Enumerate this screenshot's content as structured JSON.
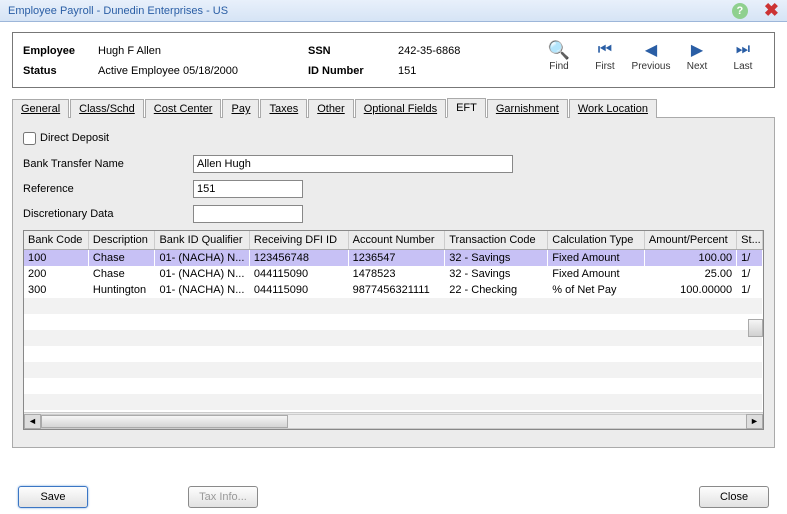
{
  "window": {
    "title": "Employee Payroll - Dunedin Enterprises - US"
  },
  "info": {
    "employee_label": "Employee",
    "employee_value": "Hugh F Allen",
    "status_label": "Status",
    "status_value": "Active Employee 05/18/2000",
    "ssn_label": "SSN",
    "ssn_value": "242-35-6868",
    "id_label": "ID Number",
    "id_value": "151"
  },
  "nav": {
    "find": "Find",
    "first": "First",
    "previous": "Previous",
    "next": "Next",
    "last": "Last"
  },
  "tabs": {
    "general": "General",
    "class": "Class/Schd",
    "cost": "Cost Center",
    "pay": "Pay",
    "taxes": "Taxes",
    "other": "Other",
    "optional": "Optional Fields",
    "eft": "EFT",
    "garnishment": "Garnishment",
    "work": "Work Location"
  },
  "eft": {
    "direct_deposit_label": "Direct Deposit",
    "bank_transfer_label": "Bank Transfer Name",
    "bank_transfer_value": "Allen Hugh",
    "reference_label": "Reference",
    "reference_value": "151",
    "discretionary_label": "Discretionary Data",
    "discretionary_value": ""
  },
  "grid": {
    "headers": {
      "bank_code": "Bank Code",
      "description": "Description",
      "bank_id_qualifier": "Bank ID Qualifier",
      "receiving_dfi": "Receiving DFI ID",
      "account_number": "Account Number",
      "transaction_code": "Transaction Code",
      "calculation_type": "Calculation Type",
      "amount_percent": "Amount/Percent",
      "start": "St..."
    },
    "rows": [
      {
        "bank_code": "100",
        "description": "Chase",
        "qualifier": "01- (NACHA) N...",
        "dfi": "123456748",
        "acct": "1236547",
        "txn": "32 - Savings",
        "calc": "Fixed Amount",
        "amt": "100.00",
        "start": "1/"
      },
      {
        "bank_code": "200",
        "description": "Chase",
        "qualifier": "01- (NACHA) N...",
        "dfi": "044115090",
        "acct": "1478523",
        "txn": "32 - Savings",
        "calc": "Fixed Amount",
        "amt": "25.00",
        "start": "1/"
      },
      {
        "bank_code": "300",
        "description": "Huntington",
        "qualifier": "01- (NACHA) N...",
        "dfi": "044115090",
        "acct": "9877456321111",
        "txn": "22 - Checking",
        "calc": "% of Net Pay",
        "amt": "100.00000",
        "start": "1/"
      }
    ]
  },
  "footer": {
    "save": "Save",
    "tax_info": "Tax Info...",
    "close": "Close"
  }
}
